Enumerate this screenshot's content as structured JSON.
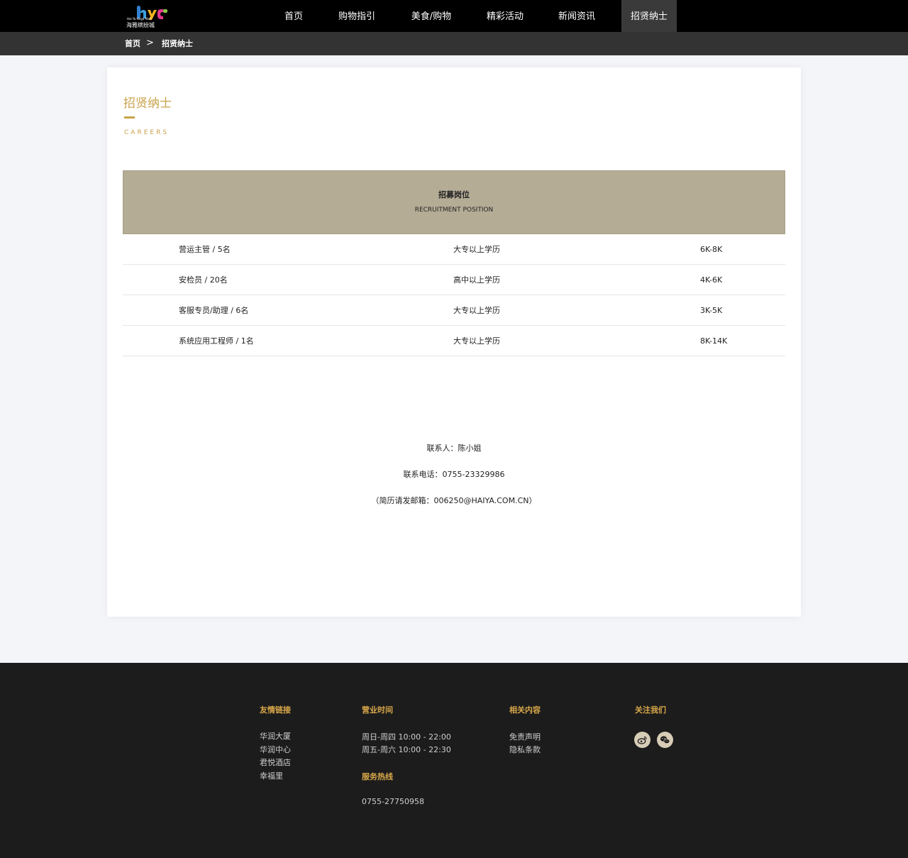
{
  "header": {
    "logo_text_en": "Hai Ya Mega Mall",
    "logo_text_cn": "海雅缤纷城",
    "nav": [
      {
        "label": "首页"
      },
      {
        "label": "购物指引"
      },
      {
        "label": "美食/购物"
      },
      {
        "label": "精彩活动"
      },
      {
        "label": "新闻资讯"
      },
      {
        "label": "招贤纳士",
        "active": true
      }
    ]
  },
  "breadcrumb": {
    "home": "首页",
    "separator": ">",
    "current": "招贤纳士"
  },
  "section": {
    "title": "招贤纳士",
    "subtitle": "CAREERS"
  },
  "table": {
    "header_cn": "招募岗位",
    "header_en": "RECRUITMENT POSITION",
    "rows": [
      {
        "position": "营运主管 / 5名",
        "education": "大专以上学历",
        "salary": "6K-8K"
      },
      {
        "position": "安检员 / 20名",
        "education": "高中以上学历",
        "salary": "4K-6K"
      },
      {
        "position": "客服专员/助理 / 6名",
        "education": "大专以上学历",
        "salary": "3K-5K"
      },
      {
        "position": "系统应用工程师 / 1名",
        "education": "大专以上学历",
        "salary": "8K-14K"
      }
    ]
  },
  "contact": {
    "person": "联系人：陈小姐",
    "phone": "联系电话：0755-23329986",
    "email": "（简历请发邮箱：006250@HAIYA.COM.CN）"
  },
  "footer": {
    "links_title": "友情链接",
    "links": [
      "华润大厦",
      "华润中心",
      "君悦酒店",
      "幸福里"
    ],
    "hours_title": "营业时间",
    "hours": [
      "周日-周四 10:00 - 22:00",
      "周五-周六 10:00 - 22:30"
    ],
    "hotline_title": "服务热线",
    "hotline": "0755-27750958",
    "related_title": "相关内容",
    "related": [
      "免责声明",
      "隐私条款"
    ],
    "follow_title": "关注我们",
    "social_icons": [
      "weibo-icon",
      "wechat-icon"
    ],
    "accent_color": "#d9a84a"
  },
  "colors": {
    "gold": "#c9a24a",
    "table_header": "#b5ac96",
    "nav_active": "#3a3a3a"
  }
}
